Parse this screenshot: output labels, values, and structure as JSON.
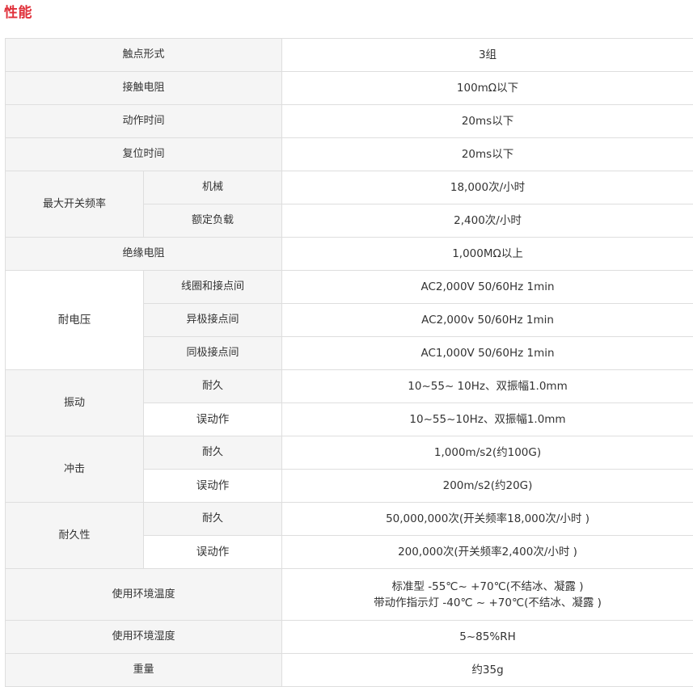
{
  "heading": "性能",
  "rows": {
    "contact_form": {
      "label": "触点形式",
      "value": "3组"
    },
    "contact_resistance": {
      "label": "接触电阻",
      "value": "100mΩ以下"
    },
    "operate_time": {
      "label": "动作时间",
      "value": "20ms以下"
    },
    "reset_time": {
      "label": "复位时间",
      "value": "20ms以下"
    },
    "max_switching_freq": {
      "label": "最大开关频率",
      "mechanical": {
        "label": "机械",
        "value": "18,000次/小时"
      },
      "rated_load": {
        "label": "额定负载",
        "value": "2,400次/小时"
      }
    },
    "insulation_resistance": {
      "label": "绝缘电阻",
      "value": "1,000MΩ以上"
    },
    "dielectric_strength": {
      "label": "耐电压",
      "coil_contact": {
        "label": "线圈和接点间",
        "value": "AC2,000V 50/60Hz 1min"
      },
      "diff_pole": {
        "label": "异极接点间",
        "value": "AC2,000v 50/60Hz 1min"
      },
      "same_pole": {
        "label": "同极接点间",
        "value": "AC1,000V 50/60Hz 1min"
      }
    },
    "vibration": {
      "label": "振动",
      "durability": {
        "label": "耐久",
        "value": "10~55~ 10Hz、双振幅1.0mm"
      },
      "malfunction": {
        "label": "误动作",
        "value": "10~55~10Hz、双振幅1.0mm"
      }
    },
    "shock": {
      "label": "冲击",
      "durability": {
        "label": "耐久",
        "value": "1,000m/s2(约100G)"
      },
      "malfunction": {
        "label": "误动作",
        "value": "200m/s2(约20G)"
      }
    },
    "endurance": {
      "label": "耐久性",
      "durability": {
        "label": "耐久",
        "value": "50,000,000次(开关频率18,000次/小时 )"
      },
      "malfunction": {
        "label": "误动作",
        "value": "200,000次(开关频率2,400次/小时 )"
      }
    },
    "ambient_temp": {
      "label": "使用环境温度",
      "value_line1": "标准型 -55℃~ +70℃(不结冰、凝露 )",
      "value_line2": "带动作指示灯 -40℃ ~ +70℃(不结冰、凝露 )"
    },
    "ambient_humidity": {
      "label": "使用环境湿度",
      "value": "5~85%RH"
    },
    "weight": {
      "label": "重量",
      "value": "约35g"
    }
  }
}
